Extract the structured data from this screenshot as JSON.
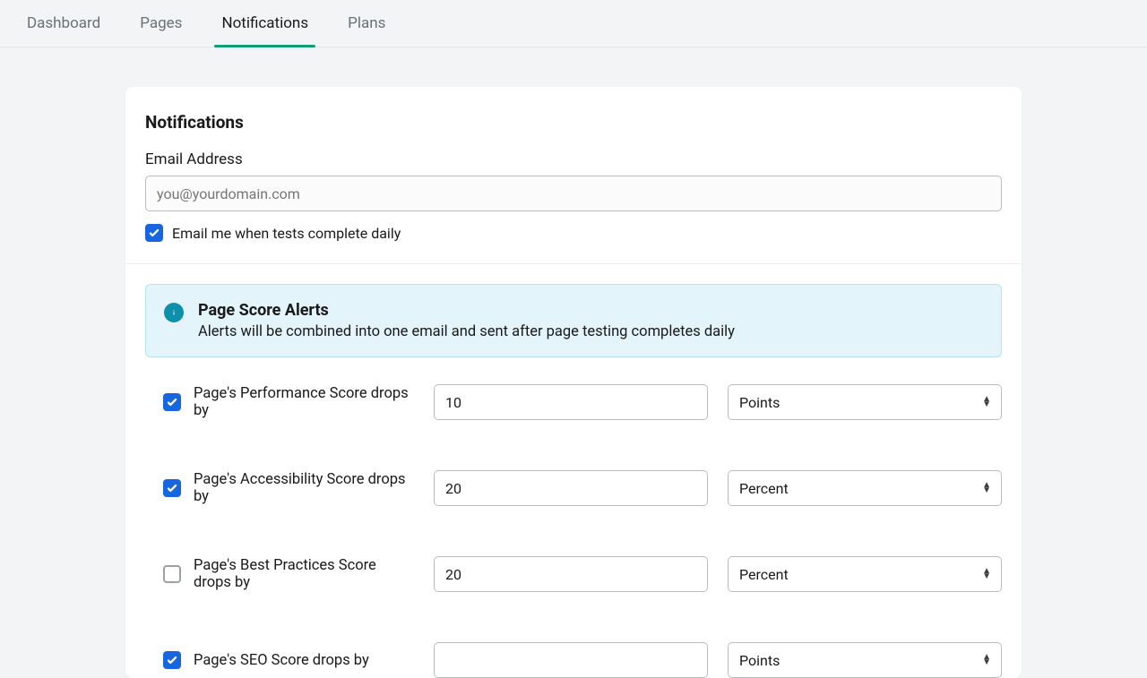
{
  "tabs": [
    {
      "label": "Dashboard",
      "active": false
    },
    {
      "label": "Pages",
      "active": false
    },
    {
      "label": "Notifications",
      "active": true
    },
    {
      "label": "Plans",
      "active": false
    }
  ],
  "notifications": {
    "heading": "Notifications",
    "emailLabel": "Email Address",
    "emailPlaceholder": "you@yourdomain.com",
    "dailyCheckbox": {
      "checked": true,
      "label": "Email me when tests complete daily"
    }
  },
  "banner": {
    "title": "Page Score Alerts",
    "subtitle": "Alerts will be combined into one email and sent after page testing completes daily"
  },
  "unitOptions": [
    "Points",
    "Percent"
  ],
  "alerts": [
    {
      "checked": true,
      "label": "Page's Performance Score drops by",
      "value": "10",
      "unit": "Points"
    },
    {
      "checked": true,
      "label": "Page's Accessibility Score drops by",
      "value": "20",
      "unit": "Percent"
    },
    {
      "checked": false,
      "label": "Page's Best Practices Score drops by",
      "value": "20",
      "unit": "Percent"
    },
    {
      "checked": true,
      "label": "Page's SEO Score drops by",
      "value": "",
      "unit": ""
    }
  ]
}
